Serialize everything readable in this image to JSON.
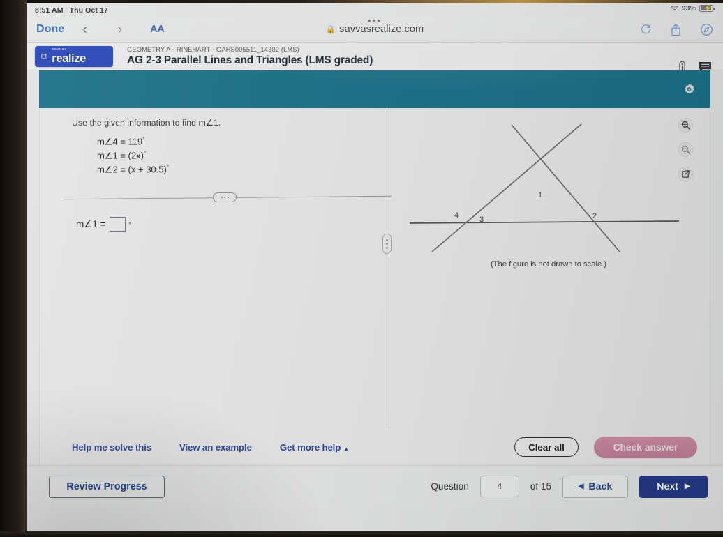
{
  "status_bar": {
    "time": "8:51 AM",
    "date": "Thu Oct 17",
    "battery_percent": "93%",
    "wifi_icon": "wifi-icon",
    "battery_icon": "battery-charging-icon"
  },
  "browser": {
    "done_label": "Done",
    "back_icon": "chevron-left-icon",
    "forward_icon": "chevron-right-icon",
    "text_size_label": "AA",
    "url": "savvasrealize.com",
    "lock_icon": "lock-icon",
    "reload_icon": "reload-icon",
    "share_icon": "share-icon",
    "compass_icon": "compass-icon",
    "tab_dots": "•••"
  },
  "app_header": {
    "logo_small": "savvas",
    "logo_main": "realize",
    "logo_icon": "external-link-icon",
    "course_line": "GEOMETRY A - RINEHART - GAHS005511_14302 (LMS)",
    "assignment_title": "AG 2-3 Parallel Lines and Triangles (LMS graded)",
    "info_icon": "info-icon",
    "message_icon": "message-icon",
    "banner_color": "#16748f",
    "gear_icon": "gear-icon"
  },
  "question": {
    "prompt": "Use the given information to find m∠1.",
    "givens": [
      {
        "lhs": "m∠4 =",
        "rhs": "119",
        "degree": "°"
      },
      {
        "lhs": "m∠1 =",
        "rhs": "(2x)",
        "degree": "°"
      },
      {
        "lhs": "m∠2 =",
        "rhs": "(x + 30.5)",
        "degree": "°"
      }
    ],
    "divider_dots_icon": "more-options-icon",
    "answer_label": "m∠1 =",
    "answer_value": "",
    "answer_degree": "°"
  },
  "figure": {
    "caption": "(The figure is not drawn to scale.)",
    "labels": [
      "1",
      "4",
      "3",
      "2"
    ],
    "zoom_in_icon": "zoom-in-icon",
    "zoom_out_icon": "zoom-out-icon",
    "popout_icon": "popout-icon",
    "splitter_icon": "splitter-handle-icon"
  },
  "help_row": {
    "links": [
      {
        "label": "Help me solve this"
      },
      {
        "label": "View an example"
      },
      {
        "label": "Get more help",
        "caret": "▲"
      }
    ],
    "clear_all_label": "Clear all",
    "check_answer_label": "Check answer",
    "check_answer_color": "#c97f9b"
  },
  "bottom_bar": {
    "review_progress_label": "Review Progress",
    "question_label": "Question",
    "question_number": "4",
    "of_label": "of 15",
    "back_label": "Back",
    "back_icon": "triangle-left-icon",
    "next_label": "Next",
    "next_icon": "triangle-right-icon",
    "next_color": "#21378f"
  }
}
